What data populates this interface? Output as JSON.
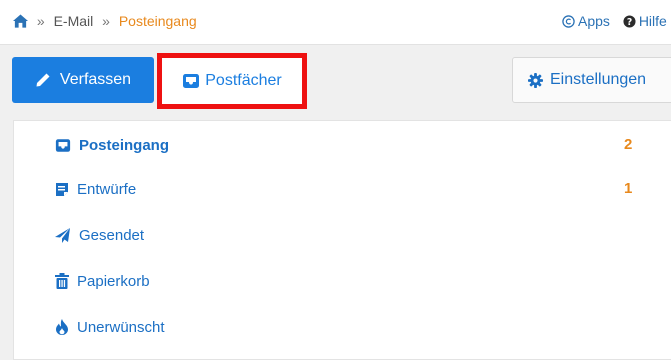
{
  "colors": {
    "accent": "#1b7ee0",
    "active": "#e8891d",
    "highlight": "#ee1111"
  },
  "breadcrumb": {
    "home_icon": "home-icon",
    "separator": "»",
    "items": [
      "E-Mail",
      "Posteingang"
    ]
  },
  "top_links": [
    {
      "icon": "copyright-circle-icon",
      "label": "Apps"
    },
    {
      "icon": "question-circle-icon",
      "label": "Hilfe"
    }
  ],
  "toolbar": {
    "compose_label": "Verfassen",
    "compose_icon": "pencil-icon",
    "mailboxes_label": "Postfächer",
    "mailboxes_icon": "inbox-icon",
    "settings_label": "Einstellungen",
    "settings_icon": "gear-icon"
  },
  "folders": [
    {
      "label": "Posteingang",
      "icon": "inbox-icon",
      "count": "2",
      "active": true
    },
    {
      "label": "Entwürfe",
      "icon": "draft-icon",
      "count": "1",
      "active": false
    },
    {
      "label": "Gesendet",
      "icon": "paper-plane-icon",
      "count": "",
      "active": false
    },
    {
      "label": "Papierkorb",
      "icon": "trash-icon",
      "count": "",
      "active": false
    },
    {
      "label": "Unerwünscht",
      "icon": "fire-icon",
      "count": "",
      "active": false
    }
  ]
}
